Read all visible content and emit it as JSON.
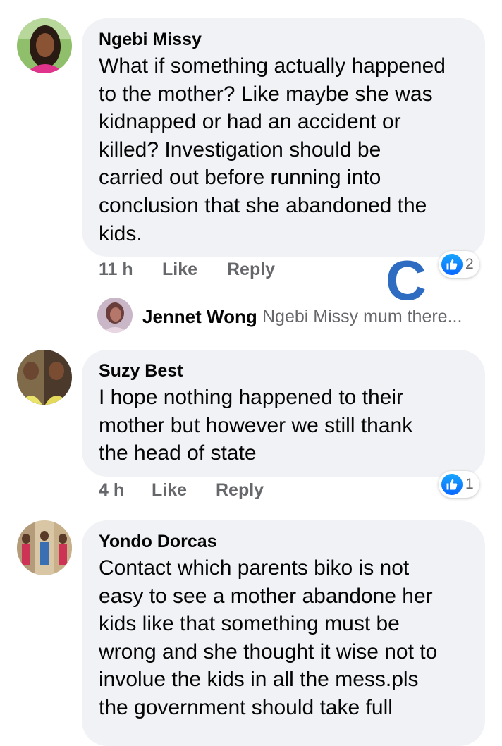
{
  "comments": [
    {
      "author": "Ngebi Missy",
      "text": "What if something actually happened\nto the mother?  Like maybe she was\nkidnapped or had an accident  or\nkilled? Investigation should be\ncarried out before running into\nconclusion that she abandoned the\nkids.",
      "time": "11 h",
      "like_label": "Like",
      "reply_label": "Reply",
      "reaction_count": "2",
      "reaction_icon": "thumbs-up-icon",
      "reply_preview": {
        "author": "Jennet Wong",
        "text": "Ngebi Missy mum there..."
      }
    },
    {
      "author": "Suzy Best",
      "text": "I hope nothing happened to their\nmother but however we still thank\nthe head of state",
      "time": "4 h",
      "like_label": "Like",
      "reply_label": "Reply",
      "reaction_count": "1",
      "reaction_icon": "thumbs-up-icon"
    },
    {
      "author": "Yondo Dorcas",
      "text": "Contact which parents biko is not\neasy to see a mother abandone her\nkids like that something must be\nwrong and she thought it wise not to\ninvolue the kids in all the mess.pls\nthe government should take full"
    }
  ],
  "watermark": "C",
  "colors": {
    "bubble": "#f0f2f5",
    "meta_text": "#65676b",
    "like_blue": "#0866ff",
    "watermark": "#2d6cc0"
  }
}
